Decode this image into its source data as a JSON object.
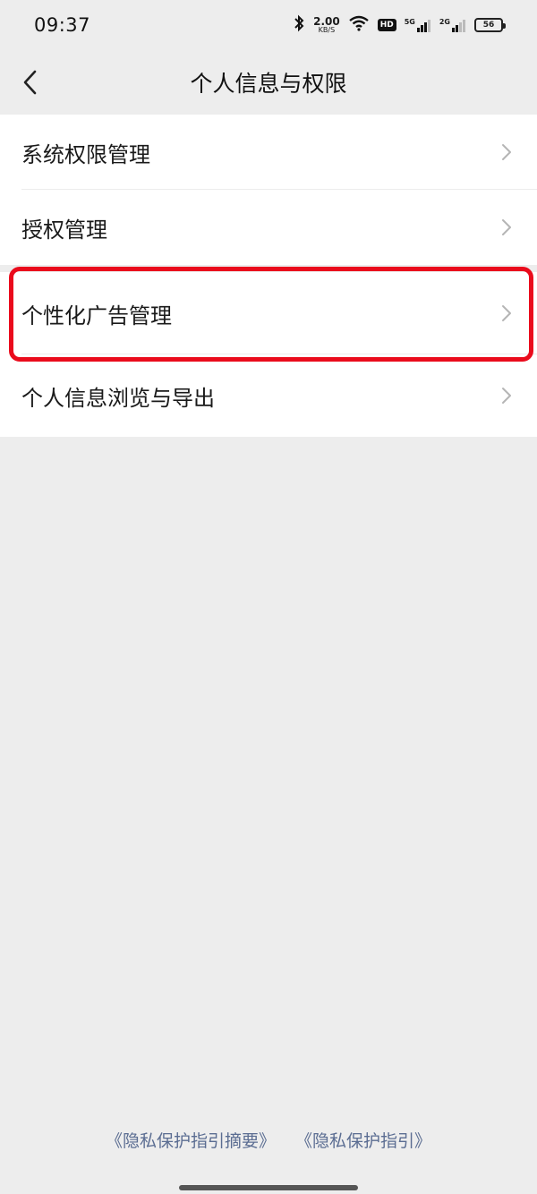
{
  "status_bar": {
    "time": "09:37",
    "net_speed_value": "2.00",
    "net_speed_unit": "KB/S",
    "hd_label": "HD",
    "signal1_label": "5G",
    "signal2_label": "2G",
    "battery_level": "56"
  },
  "nav": {
    "title": "个人信息与权限"
  },
  "list_group_1": [
    {
      "label": "系统权限管理"
    },
    {
      "label": "授权管理"
    }
  ],
  "list_group_2": [
    {
      "label": "个性化广告管理"
    },
    {
      "label": "个人信息浏览与导出"
    }
  ],
  "footer": {
    "link1": "《隐私保护指引摘要》",
    "link2": "《隐私保护指引》"
  },
  "colors": {
    "highlight": "#ea0b1c",
    "link": "#5b6d92",
    "background": "#ededed"
  }
}
